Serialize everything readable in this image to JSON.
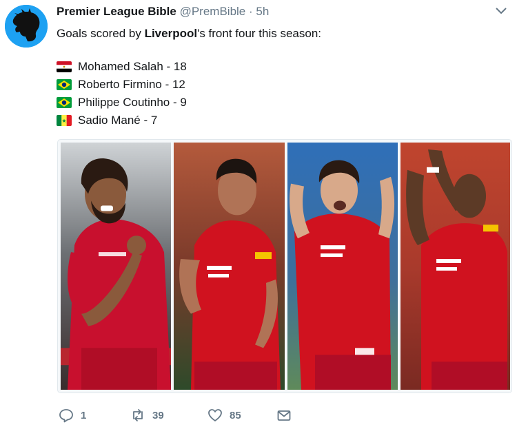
{
  "tweet": {
    "author_name": "Premier League Bible",
    "handle": "@PremBible",
    "separator": "·",
    "time": "5h",
    "text_prefix": "Goals scored by ",
    "text_bold": "Liverpool",
    "text_suffix": "'s front four this season:",
    "players": [
      {
        "flag": "egypt-flag-icon",
        "label": "Mohamed Salah - 18"
      },
      {
        "flag": "brazil-flag-icon",
        "label": "Roberto Firmino - 12"
      },
      {
        "flag": "brazil-flag-icon",
        "label": "Philippe Coutinho - 9"
      },
      {
        "flag": "senegal-flag-icon",
        "label": "Sadio Mané - 7"
      }
    ],
    "actions": {
      "reply_count": "1",
      "retweet_count": "39",
      "like_count": "85"
    }
  },
  "colors": {
    "accent": "#1da1f2",
    "muted": "#657786",
    "text": "#14171a",
    "kit_red": "#d0121f"
  },
  "icons": {
    "avatar": "lion-avatar-icon",
    "caret": "chevron-down-icon",
    "reply": "reply-icon",
    "retweet": "retweet-icon",
    "like": "heart-icon",
    "message": "envelope-icon"
  }
}
